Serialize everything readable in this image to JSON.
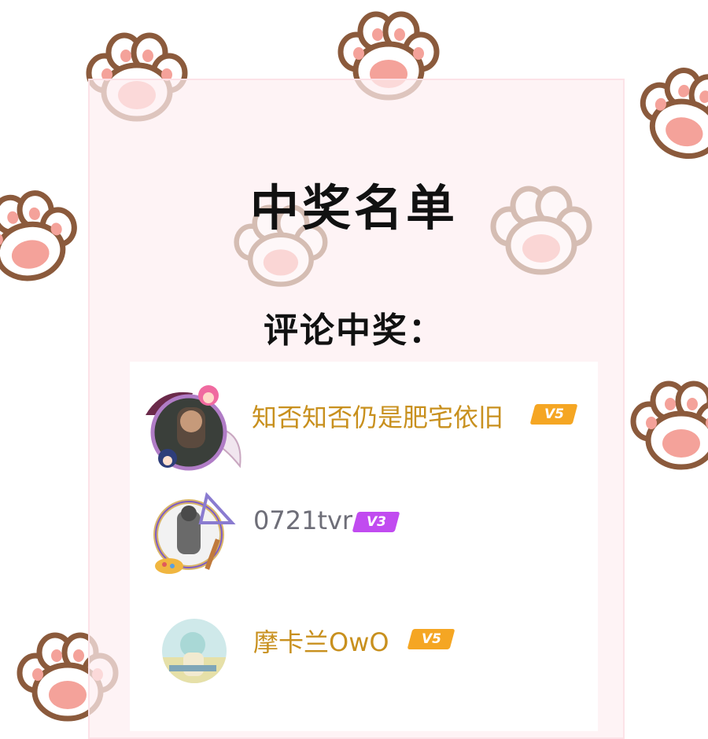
{
  "title": "中奖名单",
  "subtitle": "评论中奖：",
  "winners": [
    {
      "name": "知否知否仍是肥宅依旧",
      "level": "V5",
      "name_color": "#c8901e",
      "badge_color": "#f5a623"
    },
    {
      "name": "0721tvr",
      "level": "V3",
      "name_color": "#6e6e78",
      "badge_color": "#c14bf0"
    },
    {
      "name": "摩卡兰OwO",
      "level": "V5",
      "name_color": "#c8901e",
      "badge_color": "#f5a623"
    }
  ],
  "colors": {
    "paw_outline": "#8b5a3c",
    "paw_pad": "#f4a29a",
    "card_bg": "#fdeef1"
  },
  "icons": [
    "paw-icon",
    "avatar-frame-icon",
    "vip-badge-icon"
  ]
}
